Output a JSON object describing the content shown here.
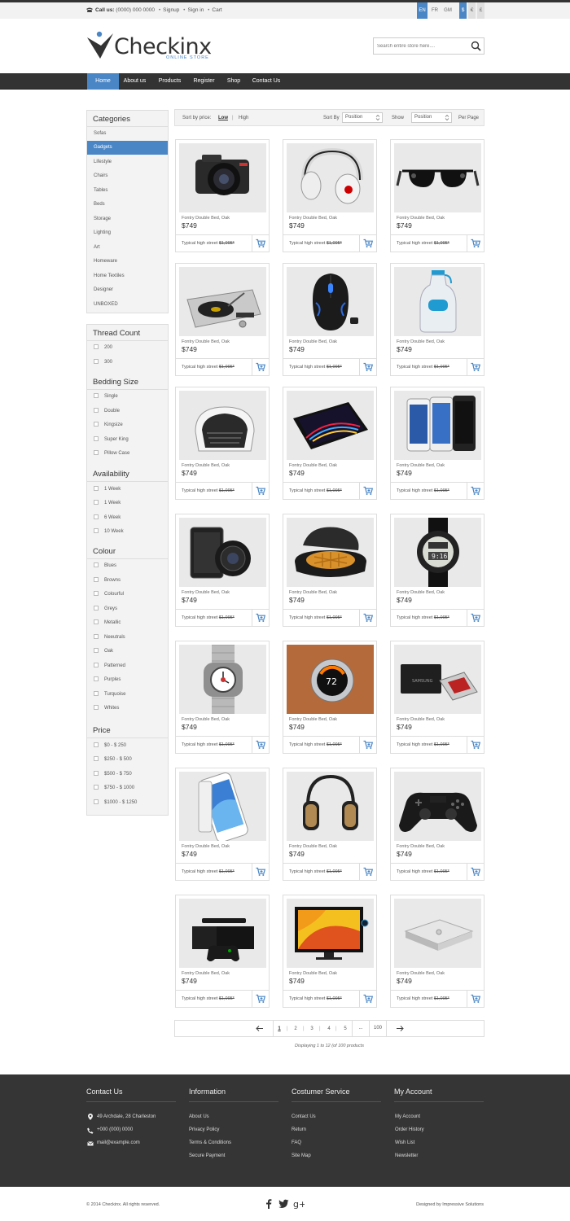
{
  "topbar": {
    "call_label": "Call us:",
    "phone": "(0000) 000 0000",
    "links": [
      "Signup",
      "Sign in",
      "Cart"
    ],
    "languages": [
      "EN",
      "FR",
      "GM"
    ],
    "currencies": [
      "$",
      "€",
      "£"
    ]
  },
  "header": {
    "logo_text": "Checkinx",
    "logo_sub": "ONLINE STORE",
    "search_placeholder": "Search entire store here....",
    "accent_color": "#4a86c6"
  },
  "nav": {
    "items": [
      "Home",
      "About us",
      "Products",
      "Register",
      "Shop",
      "Contact Us"
    ]
  },
  "sidebar": {
    "categories_title": "Categories",
    "categories": [
      "Sofas",
      "Gadgets",
      "Lifestyle",
      "Chairs",
      "Tables",
      "Beds",
      "Storage",
      "Lighting",
      "Art",
      "Homeware",
      "Home Textiles",
      "Designer",
      "UNBOXED"
    ],
    "thread_title": "Thread Count",
    "thread": [
      "200",
      "300"
    ],
    "bedding_title": "Bedding Size",
    "bedding": [
      "Single",
      "Double",
      "Kingsize",
      "Super King",
      "Pillow Case"
    ],
    "availability_title": "Availability",
    "availability": [
      "1 Week",
      "1 Week",
      "6 Week",
      "10 Week"
    ],
    "colour_title": "Colour",
    "colour": [
      "Blues",
      "Browns",
      "Colourful",
      "Greys",
      "Metallic",
      "Neeutrals",
      "Oak",
      "Patterned",
      "Purples",
      "Turquoise",
      "Whites"
    ],
    "price_title": "Price",
    "price": [
      "$0 - $ 250",
      "$250 - $ 500",
      "$500 - $ 750",
      "$750 - $ 1000",
      "$1000 - $ 1250"
    ]
  },
  "sortbar": {
    "sort_by_price": "Sort by price:",
    "low": "Low",
    "divider": "|",
    "high": "High",
    "sort_by": "Sort By",
    "sort_value": "Position",
    "show": "Show",
    "show_value": "Position",
    "per_page": "Per Page"
  },
  "product_common": {
    "name": "Fontry Double Bed, Oak",
    "price": "$749",
    "typical": "Typical high street",
    "old_price": "$1,095*"
  },
  "products": [
    {
      "icon": "camera"
    },
    {
      "icon": "headphones"
    },
    {
      "icon": "sunglasses"
    },
    {
      "icon": "turntable"
    },
    {
      "icon": "mouse"
    },
    {
      "icon": "water-bottle"
    },
    {
      "icon": "speaker"
    },
    {
      "icon": "tablet"
    },
    {
      "icon": "phones"
    },
    {
      "icon": "lens-camera"
    },
    {
      "icon": "waffle-maker"
    },
    {
      "icon": "sport-watch"
    },
    {
      "icon": "smartwatch"
    },
    {
      "icon": "thermostat"
    },
    {
      "icon": "ssd"
    },
    {
      "icon": "smartphone"
    },
    {
      "icon": "studio-headphones"
    },
    {
      "icon": "gamepad"
    },
    {
      "icon": "console"
    },
    {
      "icon": "television"
    },
    {
      "icon": "mini-pc"
    }
  ],
  "pagination": {
    "pages": [
      "1",
      "2",
      "3",
      "4",
      "5"
    ],
    "ellipsis": "...",
    "last": "100",
    "displaying": "Displaying 1 to 12 (of 100 products"
  },
  "footer": {
    "contact_title": "Contact Us",
    "address": "49 Archdale, 28 Charleston",
    "phone": "+000 (000) 0000",
    "email": "mail@example.com",
    "information_title": "Information",
    "information": [
      "About Us",
      "Privacy Policy",
      "Terms & Conditions",
      "Secure Payment"
    ],
    "service_title": "Costumer Service",
    "service": [
      "Contact Us",
      "Return",
      "FAQ",
      "Site Map"
    ],
    "account_title": "My Account",
    "account": [
      "My Account",
      "Order History",
      "Wish List",
      "Newsletter"
    ],
    "copyright": "© 2014 Checkinx. All rights reserved.",
    "designed": "Designed by Impressive Solutions"
  }
}
